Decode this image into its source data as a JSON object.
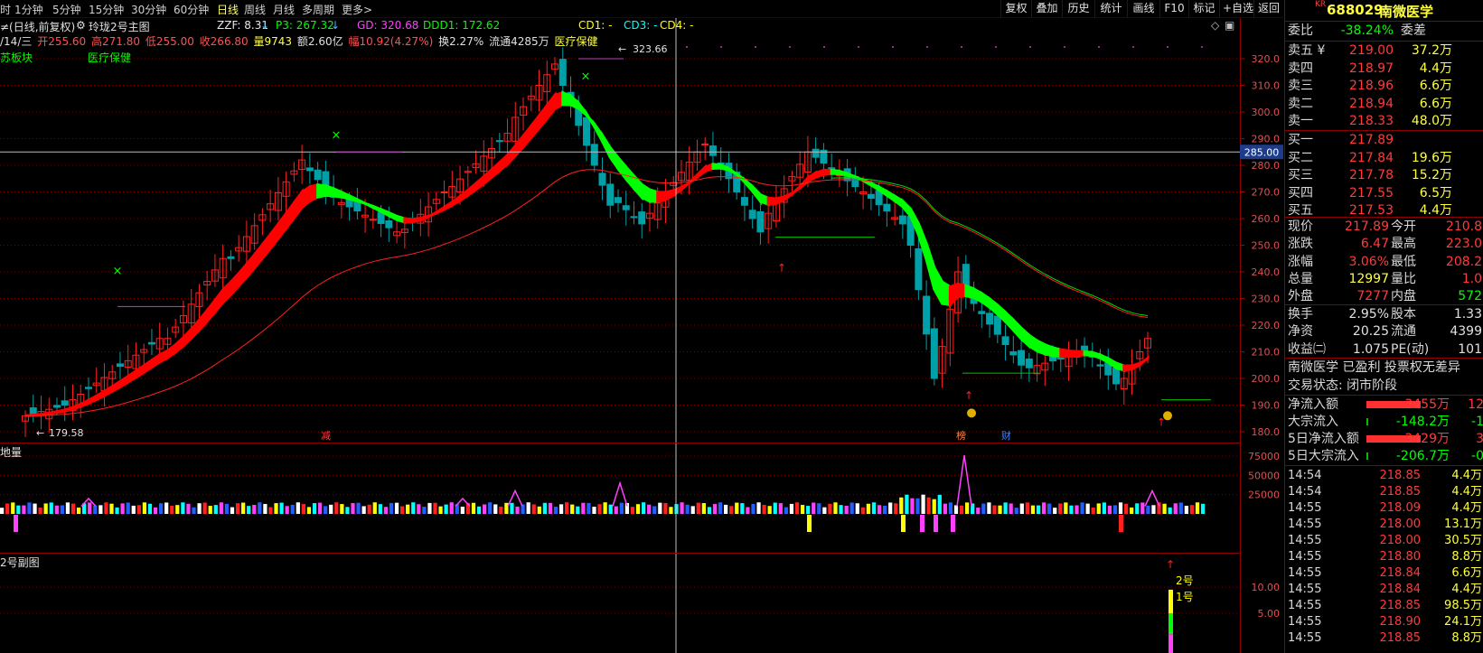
{
  "toolbar": {
    "periods": [
      "时",
      "1分钟",
      "5分钟",
      "15分钟",
      "30分钟",
      "60分钟",
      "日线",
      "周线",
      "月线",
      "多周期",
      "更多>"
    ],
    "active_period": "日线",
    "tools": [
      "复权",
      "叠加",
      "历史",
      "统计",
      "画线",
      "F10",
      "标记",
      "+自选",
      "返回"
    ]
  },
  "main_chart": {
    "title": "≠(日线,前复权)",
    "indicator": "玲珑2号主图",
    "zzf": "ZZF: 8.31",
    "p3": "P3: 267.32",
    "gd": "GD: 320.68",
    "ddd1": "DDD1: 172.62",
    "cd1": "CD1: -",
    "cd3": "CD3: -",
    "cd4": "CD4: -",
    "info_date": "/14/三",
    "info_open": "开255.60",
    "info_high": "高271.80",
    "info_low": "低255.00",
    "info_close": "收266.80",
    "info_vol": "量9743",
    "info_amt": "额2.60亿",
    "info_chg": "幅10.92(4.27%)",
    "info_turn": "换2.27%",
    "info_float": "流通4285万",
    "info_sector": "医疗保健",
    "label_sector1": "苏板块",
    "label_sector2": "医疗保健",
    "high_label": "323.66",
    "low_label": "179.58",
    "cursor_price": "285.00",
    "price_ticks": [
      "320.0",
      "310.0",
      "300.0",
      "290.0",
      "280.0",
      "270.0",
      "260.0",
      "250.0",
      "240.0",
      "230.0",
      "220.0",
      "210.0",
      "200.0",
      "190.0",
      "180.0"
    ],
    "marker_jian": "减",
    "marker_bang": "榜",
    "marker_cai": "财"
  },
  "volume_chart": {
    "title": "地量",
    "ticks": [
      "75000",
      "50000",
      "25000"
    ]
  },
  "sub_chart": {
    "title": "2号副图",
    "ticks": [
      "10.00",
      "5.00"
    ],
    "label_2": "2号",
    "label_1": "1号"
  },
  "quote": {
    "code_prefix": "KR",
    "code": "688029",
    "name": "南微医学",
    "weibi_label": "委比",
    "weibi": "-38.24%",
    "weicha_label": "委差",
    "asks": [
      {
        "label": "卖五 ¥",
        "price": "219.00",
        "vol": "37.2万"
      },
      {
        "label": "卖四",
        "price": "218.97",
        "vol": "4.4万"
      },
      {
        "label": "卖三",
        "price": "218.96",
        "vol": "6.6万"
      },
      {
        "label": "卖二",
        "price": "218.94",
        "vol": "6.6万"
      },
      {
        "label": "卖一",
        "price": "218.33",
        "vol": "48.0万"
      }
    ],
    "bids": [
      {
        "label": "买一",
        "price": "217.89",
        "vol": ""
      },
      {
        "label": "买二",
        "price": "217.84",
        "vol": "19.6万"
      },
      {
        "label": "买三",
        "price": "217.78",
        "vol": "15.2万"
      },
      {
        "label": "买四",
        "price": "217.55",
        "vol": "6.5万"
      },
      {
        "label": "买五",
        "price": "217.53",
        "vol": "4.4万"
      }
    ],
    "stats": [
      {
        "l1": "现价",
        "v1": "217.89",
        "l2": "今开",
        "v2": "210.8"
      },
      {
        "l1": "涨跌",
        "v1": "6.47",
        "l2": "最高",
        "v2": "223.0"
      },
      {
        "l1": "涨幅",
        "v1": "3.06%",
        "l2": "最低",
        "v2": "208.2"
      },
      {
        "l1": "总量",
        "v1": "12997",
        "l2": "量比",
        "v2": "1.0"
      },
      {
        "l1": "外盘",
        "v1": "7277",
        "l2": "内盘",
        "v2": "572"
      }
    ],
    "stats2": [
      {
        "l1": "换手",
        "v1": "2.95%",
        "l2": "股本",
        "v2": "1.33"
      },
      {
        "l1": "净资",
        "v1": "20.25",
        "l2": "流通",
        "v2": "4399"
      },
      {
        "l1": "收益㈡",
        "v1": "1.075",
        "l2": "PE(动)",
        "v2": "101"
      }
    ],
    "company_note": "南微医学 已盈利 投票权无差异",
    "trade_status": "交易状态: 闭市阶段",
    "flows": [
      {
        "label": "净流入额",
        "value": "3455万",
        "extra": "12"
      },
      {
        "label": "大宗流入",
        "value": "-148.2万",
        "extra": "-1"
      },
      {
        "label": "5日净流入额",
        "value": "3429万",
        "extra": "3"
      },
      {
        "label": "5日大宗流入",
        "value": "-206.7万",
        "extra": "-0"
      }
    ],
    "ticks": [
      {
        "time": "14:54",
        "price": "218.85",
        "vol": "4.4万"
      },
      {
        "time": "14:54",
        "price": "218.85",
        "vol": "4.4万"
      },
      {
        "time": "14:55",
        "price": "218.09",
        "vol": "4.4万"
      },
      {
        "time": "14:55",
        "price": "218.00",
        "vol": "13.1万"
      },
      {
        "time": "14:55",
        "price": "218.00",
        "vol": "30.5万"
      },
      {
        "time": "14:55",
        "price": "218.80",
        "vol": "8.8万"
      },
      {
        "time": "14:55",
        "price": "218.84",
        "vol": "6.6万"
      },
      {
        "time": "14:55",
        "price": "218.84",
        "vol": "4.4万"
      },
      {
        "time": "14:55",
        "price": "218.85",
        "vol": "98.5万"
      },
      {
        "time": "14:55",
        "price": "218.90",
        "vol": "24.1万"
      },
      {
        "time": "14:55",
        "price": "218.85",
        "vol": "8.8万"
      }
    ]
  }
}
